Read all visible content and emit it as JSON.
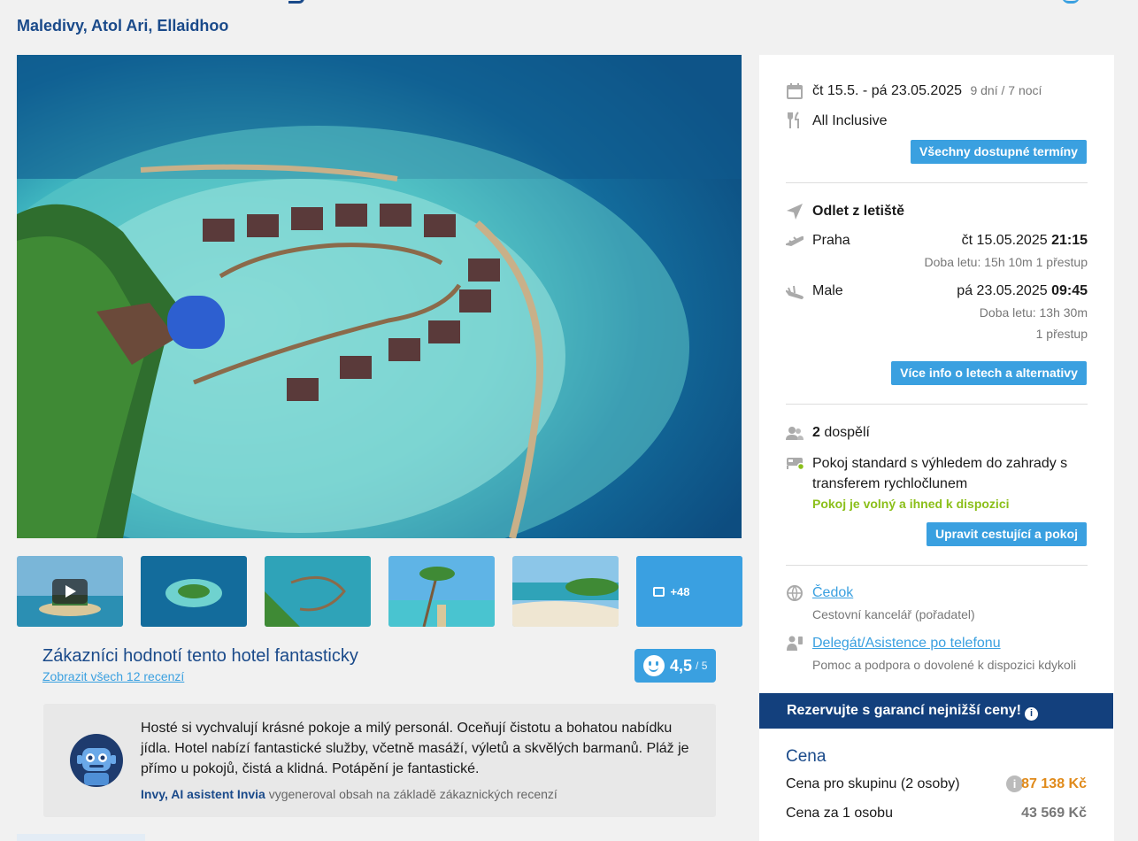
{
  "header": {
    "location": "Maledivy, Atol Ari, Ellaidhoo"
  },
  "gallery": {
    "more_count": "+48",
    "thumbnails": [
      "video-thumbnail",
      "island-aerial",
      "water-villas",
      "palm-beach-jetty",
      "beach-shore",
      "gallery-more"
    ]
  },
  "reviews": {
    "title": "Zákazníci hodnotí tento hotel fantasticky",
    "link": "Zobrazit všech 12 recenzí",
    "score": "4,5",
    "scale": "/ 5",
    "ai_summary": "Hosté si vychvalují krásné pokoje a milý personál. Oceňují čistotu a bohatou nabídku jídla. Hotel nabízí fantastické služby, včetně masáží, výletů a skvělých barmanů. Pláž je přímo u pokojů, čistá a klidná. Potápění je fantastické.",
    "ai_author": "Invy, AI asistent Invia",
    "ai_note": " vygeneroval obsah na základě zákaznických recenzí"
  },
  "booking": {
    "dates": "čt 15.5. - pá 23.05.2025",
    "duration": "9 dní / 7 nocí",
    "board": "All Inclusive",
    "dates_button": "Všechny dostupné termíny",
    "departure_heading": "Odlet z letiště",
    "outbound": {
      "city": "Praha",
      "date": "čt 15.05.2025",
      "time": "21:15",
      "info": "Doba letu: 15h 10m  1 přestup"
    },
    "inbound": {
      "city": "Male",
      "date": "pá 23.05.2025",
      "time": "09:45",
      "info": "Doba letu: 13h 30m",
      "stops": "1 přestup"
    },
    "flights_button": "Více info o letech a alternativy",
    "travelers_count": "2",
    "travelers_label": " dospělí",
    "room": "Pokoj standard s výhledem do zahrady s transferem rychločlunem",
    "room_status": "Pokoj je volný a ihned k dispozici",
    "room_button": "Upravit cestující a pokoj",
    "agency_name": "Čedok",
    "agency_desc": "Cestovní kancelář (pořadatel)",
    "assist_name": "Delegát/Asistence po telefonu",
    "assist_desc": "Pomoc a podpora o dovolené k dispozici kdykoli"
  },
  "guarantee": {
    "text": "Rezervujte s garancí nejnižší ceny!",
    "info_icon": "i"
  },
  "price": {
    "title": "Cena",
    "group_label": "Cena pro skupinu (2 osoby)",
    "group_value": "87 138 Kč",
    "person_label": "Cena za 1 osobu",
    "person_value": "43 569 Kč"
  },
  "colors": {
    "brand_blue": "#1a4a8a",
    "accent": "#3aa0e0",
    "banner": "#13407d",
    "price_orange": "#e08a1a",
    "available_green": "#8bbf1a"
  }
}
